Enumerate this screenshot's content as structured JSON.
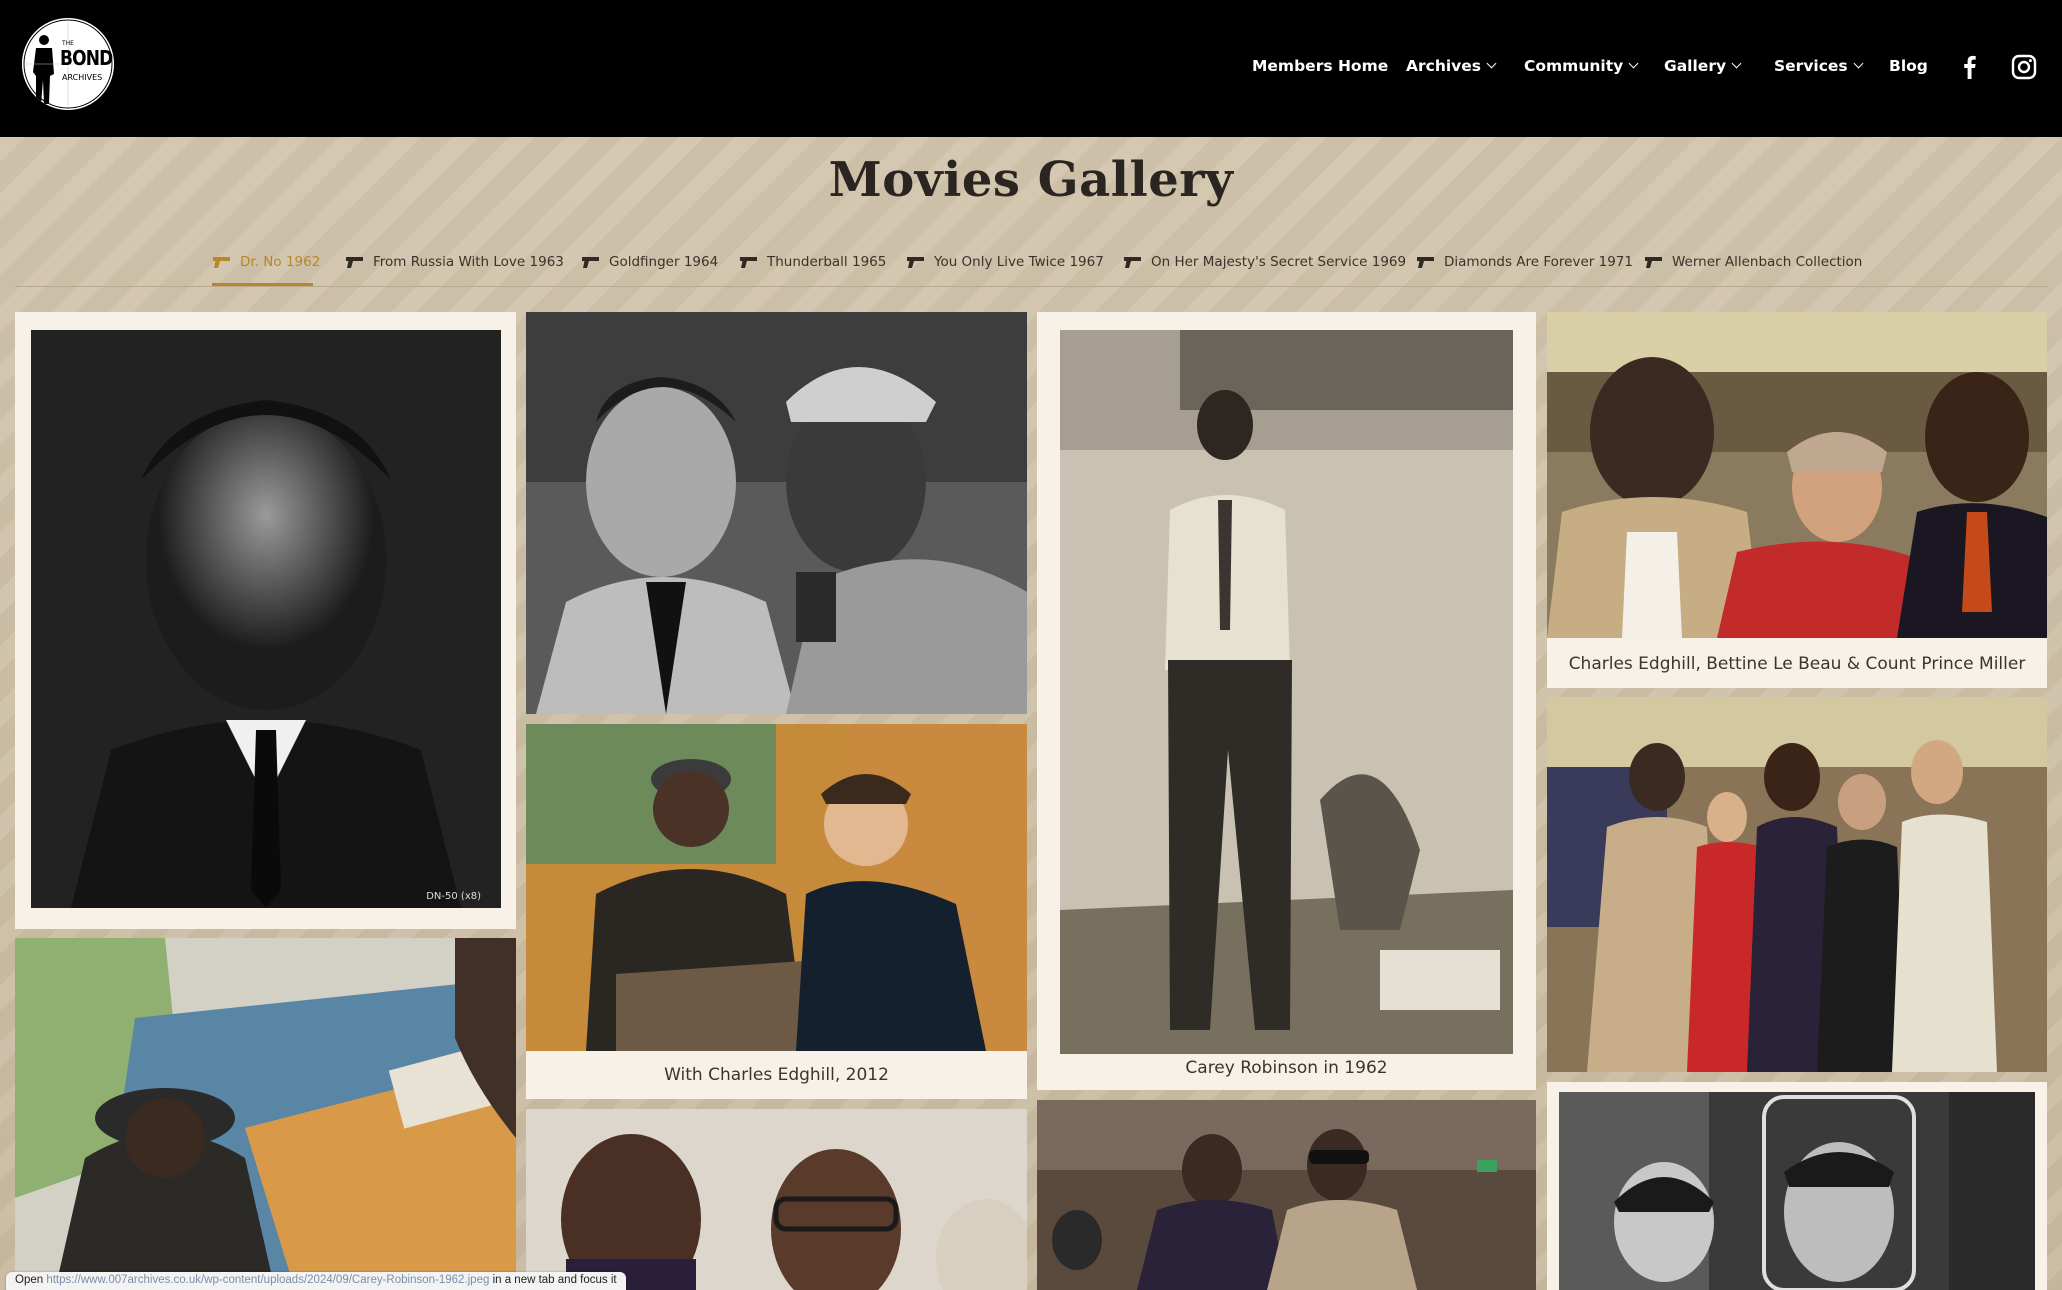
{
  "header": {
    "logo_the": "THE",
    "logo_main": "BOND",
    "logo_sub": "ARCHIVES",
    "nav": [
      {
        "label": "Members Home",
        "dropdown": false
      },
      {
        "label": "Archives",
        "dropdown": true
      },
      {
        "label": "Community",
        "dropdown": true
      },
      {
        "label": "Gallery",
        "dropdown": true
      },
      {
        "label": "Services",
        "dropdown": true
      },
      {
        "label": "Blog",
        "dropdown": false
      }
    ],
    "social": [
      "facebook-icon",
      "instagram-icon"
    ]
  },
  "page": {
    "title": "Movies Gallery",
    "tabs": [
      {
        "label": "Dr. No 1962",
        "active": true
      },
      {
        "label": "From Russia With Love 1963",
        "active": false
      },
      {
        "label": "Goldfinger 1964",
        "active": false
      },
      {
        "label": "Thunderball 1965",
        "active": false
      },
      {
        "label": "You Only Live Twice 1967",
        "active": false
      },
      {
        "label": "On Her Majesty's Secret Service 1969",
        "active": false
      },
      {
        "label": "Diamonds Are Forever 1971",
        "active": false
      },
      {
        "label": "Werner Allenbach Collection",
        "active": false
      }
    ],
    "accent_color": "#b8862b"
  },
  "gallery": {
    "items": [
      {
        "caption": "",
        "photo_stamp": "DN-50 (x8)"
      },
      {
        "caption": ""
      },
      {
        "caption": ""
      },
      {
        "caption": "With Charles Edghill, 2012"
      },
      {
        "caption": ""
      },
      {
        "caption": "Carey Robinson in 1962"
      },
      {
        "caption": ""
      },
      {
        "caption": "Charles Edghill, Bettine Le Beau & Count Prince Miller"
      },
      {
        "caption": ""
      },
      {
        "caption": ""
      }
    ]
  },
  "status_bar": {
    "prefix": "Open",
    "url": "https://www.007archives.co.uk/wp-content/uploads/2024/09/Carey-Robinson-1962.jpeg",
    "suffix": "in a new tab and focus it"
  }
}
